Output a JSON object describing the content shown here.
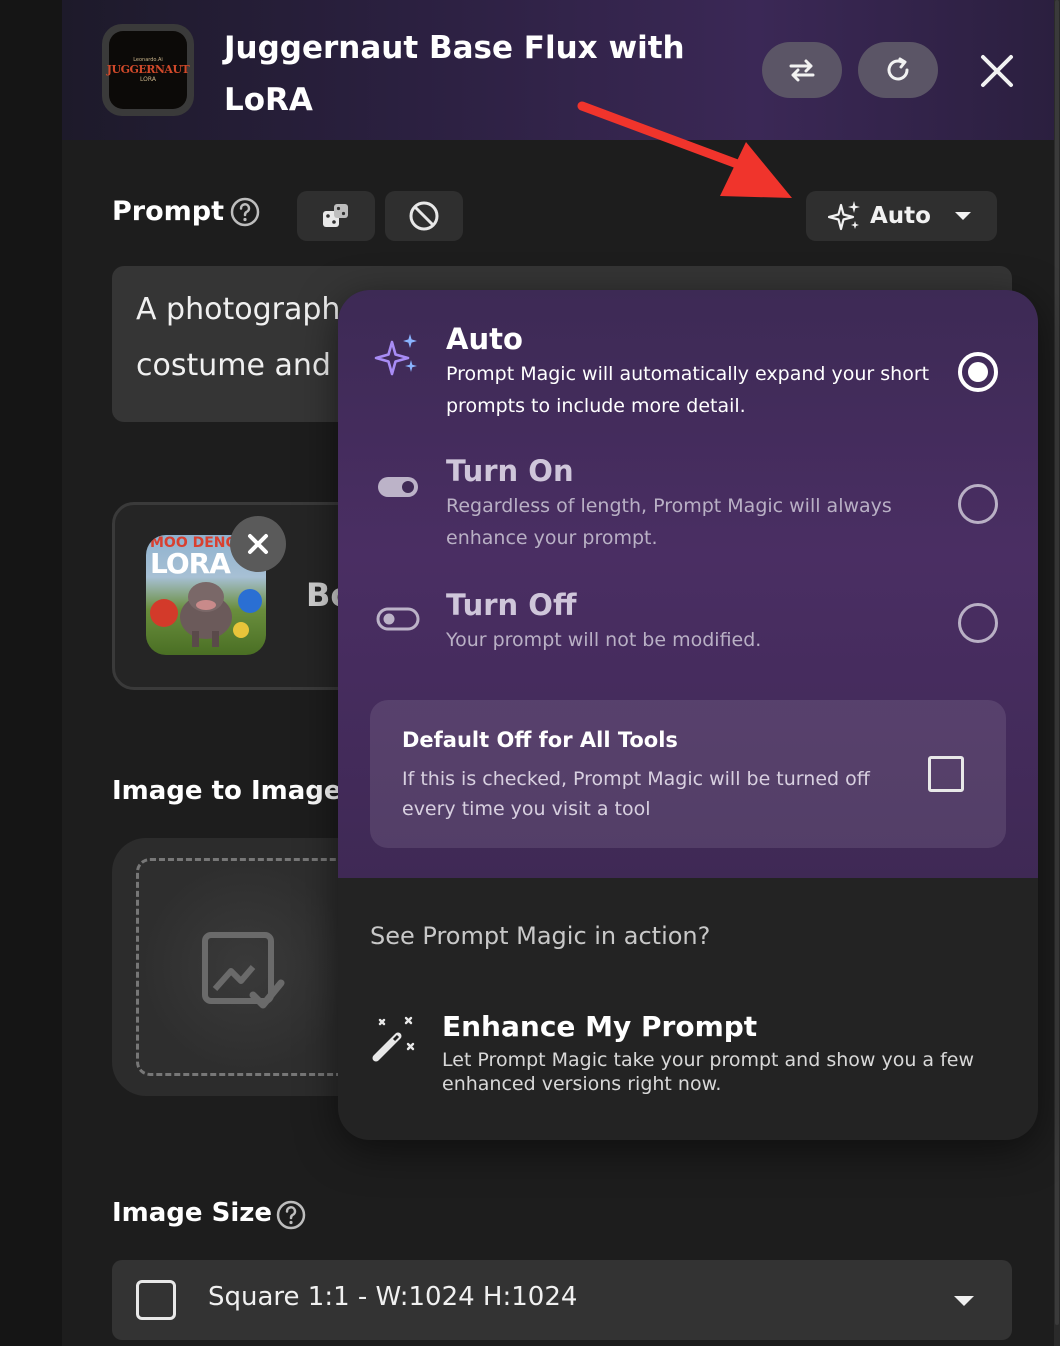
{
  "header": {
    "title": "Juggernaut Base Flux with LoRA",
    "thumb_small": "Leonardo.Ai",
    "thumb_logo": "JUGGERNAUT",
    "thumb_sub": "LORA"
  },
  "prompt": {
    "label": "Prompt",
    "text_line1": "A photograph",
    "text_line2": "costume and",
    "magic_mode": "Auto"
  },
  "lora": {
    "image_caption_top": "MOO DENG",
    "image_caption_main": "LORA",
    "name_partial": "Bo"
  },
  "image_to_image": {
    "label": "Image to Image"
  },
  "image_size": {
    "label": "Image Size",
    "selected": "Square 1:1 - W:1024 H:1024"
  },
  "magic_menu": {
    "options": [
      {
        "title": "Auto",
        "description": "Prompt Magic will automatically expand your short prompts to include more detail.",
        "selected": true
      },
      {
        "title": "Turn On",
        "description": "Regardless of length, Prompt Magic will always enhance your prompt.",
        "selected": false
      },
      {
        "title": "Turn Off",
        "description": "Your prompt will not be modified.",
        "selected": false
      }
    ],
    "default_off": {
      "title": "Default Off for All Tools",
      "description": "If this is checked, Prompt Magic will be turned off every time you visit a tool",
      "checked": false
    },
    "see_label": "See Prompt Magic in action?",
    "enhance": {
      "title": "Enhance My Prompt",
      "description": "Let Prompt Magic take your prompt and show you a few enhanced versions right now."
    }
  },
  "colors": {
    "accent_purple": "#4a2e63",
    "annotation_arrow": "#f0342c",
    "sparkle": "#a88cf5"
  }
}
